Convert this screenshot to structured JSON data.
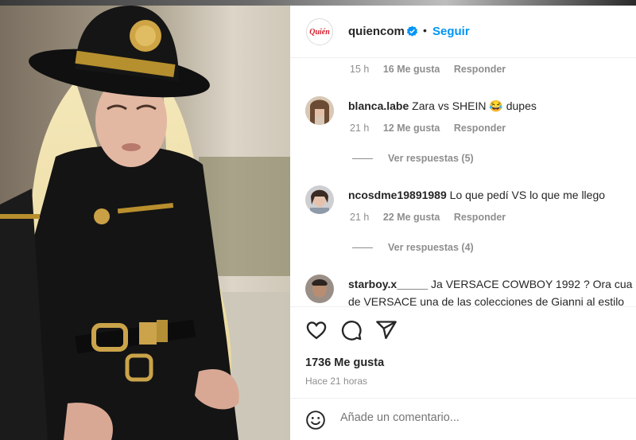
{
  "post": {
    "account": {
      "username": "quiencom",
      "logo_text": "Quién",
      "follow_label": "Seguir",
      "separator": "•"
    },
    "likes_label": "1736 Me gusta",
    "time_label": "Hace 21 horas",
    "comment_placeholder": "Añade un comentario..."
  },
  "comments": [
    {
      "user": "",
      "text": "",
      "time": "15 h",
      "likes": "16 Me gusta",
      "reply": "Responder"
    },
    {
      "user": "blanca.labe",
      "text": "Zara vs SHEIN 😂 dupes",
      "time": "21 h",
      "likes": "12 Me gusta",
      "reply": "Responder",
      "replies": "Ver respuestas (5)"
    },
    {
      "user": "ncosdme19891989",
      "text": "Lo que pedí VS lo que me llego",
      "time": "21 h",
      "likes": "22 Me gusta",
      "reply": "Responder",
      "replies": "Ver respuestas (4)"
    },
    {
      "user": "starboy.x_____",
      "text": "Ja VERSACE COWBOY 1992 ? Ora cua",
      "text2": "de VERSACE una de las colecciones de Gianni al estilo"
    }
  ],
  "icons": {
    "like": "heart-icon",
    "comment": "comment-icon",
    "share": "share-icon",
    "emoji": "emoji-icon",
    "verified": "verified-badge-icon"
  },
  "colors": {
    "accent": "#0095f6",
    "brand": "#d41c2a",
    "muted": "#8e8e8e"
  }
}
